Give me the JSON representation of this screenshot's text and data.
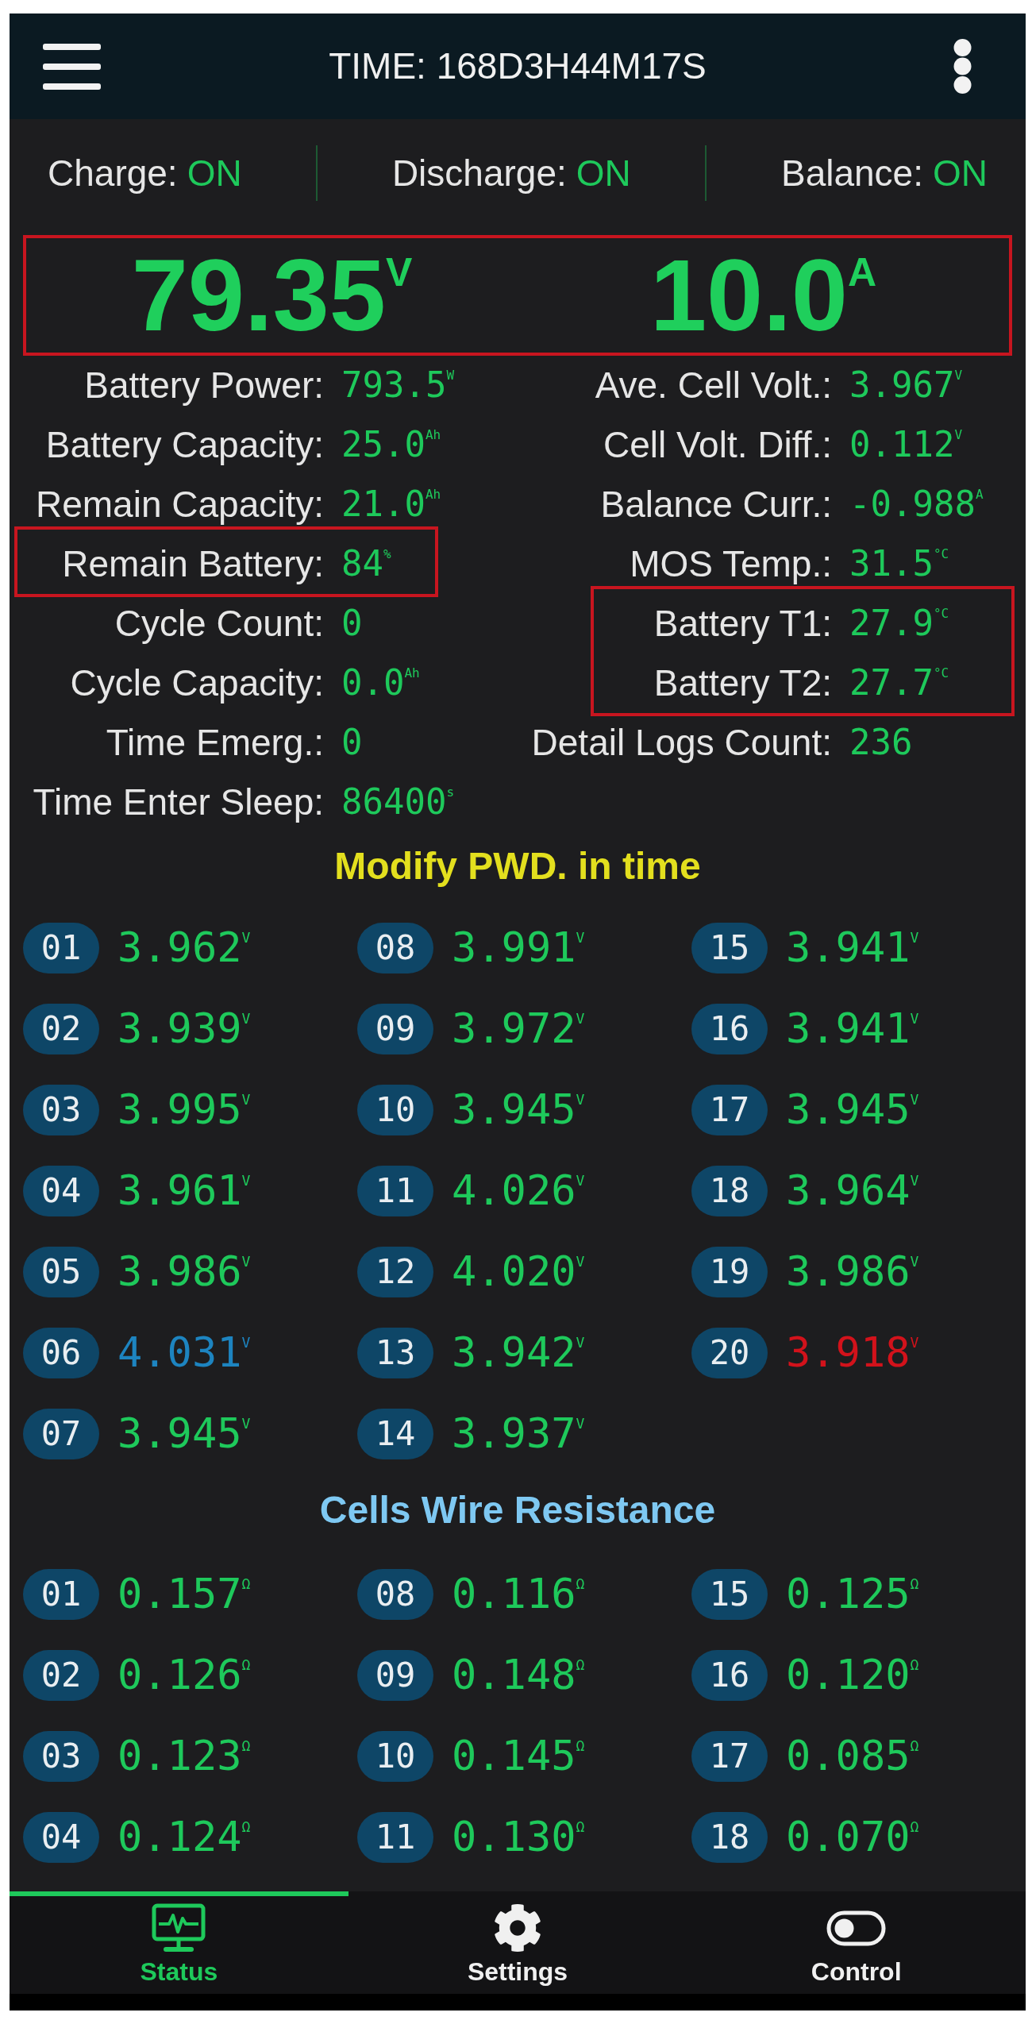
{
  "header": {
    "title": "TIME: 168D3H44M17S"
  },
  "switches": [
    {
      "label": "Charge:",
      "value": "ON",
      "on": true
    },
    {
      "label": "Discharge:",
      "value": "ON",
      "on": true
    },
    {
      "label": "Balance:",
      "value": "ON",
      "on": true
    }
  ],
  "readings": {
    "highlighted": true,
    "items": [
      "79.35$^{V}$",
      "10.0$^{A}$"
    ]
  },
  "stats": {
    "left": [
      {
        "label": "Battery Power:",
        "value": "793.5$^{W}$",
        "highlighted": false
      },
      {
        "label": "Battery Capacity:",
        "value": "25.0$^{Ah}$",
        "highlighted": false
      },
      {
        "label": "Remain Capacity:",
        "value": "21.0$^{Ah}$",
        "highlighted": false
      },
      {
        "label": "Remain Battery:",
        "value": "84$^{%}$",
        "highlighted": true
      },
      {
        "label": "Cycle Count:",
        "value": "0",
        "highlighted": false
      },
      {
        "label": "Cycle Capacity:",
        "value": "0.0$^{Ah}$",
        "highlighted": false
      },
      {
        "label": "Time Emerg.:",
        "value": "0",
        "highlighted": false
      },
      {
        "label": "Time Enter Sleep:",
        "value": "86400$^{s}$",
        "highlighted": false
      }
    ],
    "right": [
      {
        "label": "Ave. Cell Volt.:",
        "value": "3.967$^{V}$",
        "highlighted": false
      },
      {
        "label": "Cell Volt. Diff.:",
        "value": "0.112$^{V}$",
        "highlighted": false
      },
      {
        "label": "Balance Curr.:",
        "value": "-0.988$^{A}$",
        "highlighted": false
      },
      {
        "label": "MOS Temp.:",
        "value": "31.5$^{°C}$",
        "highlighted": false
      },
      {
        "label": "Battery T1:",
        "value": "27.9$^{°C}$",
        "highlighted": true
      },
      {
        "label": "Battery T2:",
        "value": "27.7$^{°C}$",
        "highlighted": true
      },
      {
        "label": "Detail Logs Count:",
        "value": "236",
        "highlighted": false
      }
    ]
  },
  "cells": {
    "title": "Modify PWD. in time",
    "items": [
      {
        "label": "01",
        "value": "3.962$^{V}$",
        "color": "#1ec95b"
      },
      {
        "label": "02",
        "value": "3.939$^{V}$",
        "color": "#1ec95b"
      },
      {
        "label": "03",
        "value": "3.995$^{V}$",
        "color": "#1ec95b"
      },
      {
        "label": "04",
        "value": "3.961$^{V}$",
        "color": "#1ec95b"
      },
      {
        "label": "05",
        "value": "3.986$^{V}$",
        "color": "#1ec95b"
      },
      {
        "label": "06",
        "value": "4.031$^{V}$",
        "color": "#1d84c0"
      },
      {
        "label": "07",
        "value": "3.945$^{V}$",
        "color": "#1ec95b"
      },
      {
        "label": "08",
        "value": "3.991$^{V}$",
        "color": "#1ec95b"
      },
      {
        "label": "09",
        "value": "3.972$^{V}$",
        "color": "#1ec95b"
      },
      {
        "label": "10",
        "value": "3.945$^{V}$",
        "color": "#1ec95b"
      },
      {
        "label": "11",
        "value": "4.026$^{V}$",
        "color": "#1ec95b"
      },
      {
        "label": "12",
        "value": "4.020$^{V}$",
        "color": "#1ec95b"
      },
      {
        "label": "13",
        "value": "3.942$^{V}$",
        "color": "#1ec95b"
      },
      {
        "label": "14",
        "value": "3.937$^{V}$",
        "color": "#1ec95b"
      },
      {
        "label": "15",
        "value": "3.941$^{V}$",
        "color": "#1ec95b"
      },
      {
        "label": "16",
        "value": "3.941$^{V}$",
        "color": "#1ec95b"
      },
      {
        "label": "17",
        "value": "3.945$^{V}$",
        "color": "#1ec95b"
      },
      {
        "label": "18",
        "value": "3.964$^{V}$",
        "color": "#1ec95b"
      },
      {
        "label": "19",
        "value": "3.986$^{V}$",
        "color": "#1ec95b"
      },
      {
        "label": "20",
        "value": "3.918$^{V}$",
        "color": "#d2121b"
      }
    ]
  },
  "wire_resistance": {
    "title": "Cells Wire Resistance",
    "items": [
      {
        "label": "01",
        "value": "0.157$^{Ω}$"
      },
      {
        "label": "02",
        "value": "0.126$^{Ω}$"
      },
      {
        "label": "03",
        "value": "0.123$^{Ω}$"
      },
      {
        "label": "04",
        "value": "0.124$^{Ω}$"
      },
      {
        "label": "08",
        "value": "0.116$^{Ω}$"
      },
      {
        "label": "09",
        "value": "0.148$^{Ω}$"
      },
      {
        "label": "10",
        "value": "0.145$^{Ω}$"
      },
      {
        "label": "11",
        "value": "0.130$^{Ω}$"
      },
      {
        "label": "15",
        "value": "0.125$^{Ω}$"
      },
      {
        "label": "16",
        "value": "0.120$^{Ω}$"
      },
      {
        "label": "17",
        "value": "0.085$^{Ω}$"
      },
      {
        "label": "18",
        "value": "0.070$^{Ω}$"
      }
    ]
  },
  "tabs": [
    {
      "label": "Status",
      "selected": true
    },
    {
      "label": "Settings",
      "selected": false
    },
    {
      "label": "Control",
      "selected": false
    }
  ]
}
